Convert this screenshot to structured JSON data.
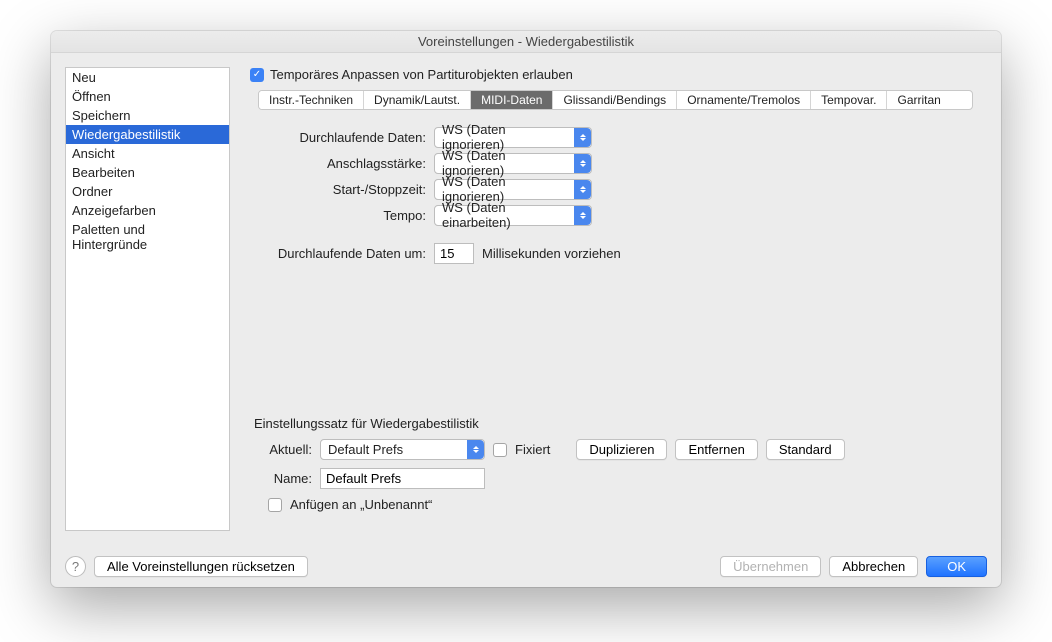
{
  "title": "Voreinstellungen - Wiedergabestilistik",
  "sidebar": {
    "items": [
      {
        "label": "Neu"
      },
      {
        "label": "Öffnen"
      },
      {
        "label": "Speichern"
      },
      {
        "label": "Wiedergabestilistik"
      },
      {
        "label": "Ansicht"
      },
      {
        "label": "Bearbeiten"
      },
      {
        "label": "Ordner"
      },
      {
        "label": "Anzeigefarben"
      },
      {
        "label": "Paletten und Hintergründe"
      }
    ],
    "selected_index": 3
  },
  "top_checkbox": {
    "label": "Temporäres Anpassen von Partiturobjekten erlauben",
    "checked": true
  },
  "tabs": {
    "items": [
      "Instr.-Techniken",
      "Dynamik/Lautst.",
      "MIDI-Daten",
      "Glissandi/Bendings",
      "Ornamente/Tremolos",
      "Tempovar.",
      "Garritan"
    ],
    "active_index": 2
  },
  "form": {
    "rows": [
      {
        "label": "Durchlaufende Daten:",
        "value": "WS (Daten ignorieren)"
      },
      {
        "label": "Anschlagsstärke:",
        "value": "WS (Daten ignorieren)"
      },
      {
        "label": "Start-/Stoppzeit:",
        "value": "WS (Daten ignorieren)"
      },
      {
        "label": "Tempo:",
        "value": "WS (Daten einarbeiten)"
      }
    ],
    "advance": {
      "prefix": "Durchlaufende Daten um:",
      "value": "15",
      "suffix": "Millisekunden vorziehen"
    }
  },
  "settings_set": {
    "title": "Einstellungssatz für Wiedergabestilistik",
    "current_label": "Aktuell:",
    "current_value": "Default Prefs",
    "fixed_label": "Fixiert",
    "fixed_checked": false,
    "duplicate": "Duplizieren",
    "remove": "Entfernen",
    "standard": "Standard",
    "name_label": "Name:",
    "name_value": "Default Prefs",
    "append_label": "Anfügen an „Unbenannt“",
    "append_checked": false
  },
  "footer": {
    "reset_all": "Alle Voreinstellungen rücksetzen",
    "apply": "Übernehmen",
    "cancel": "Abbrechen",
    "ok": "OK"
  }
}
